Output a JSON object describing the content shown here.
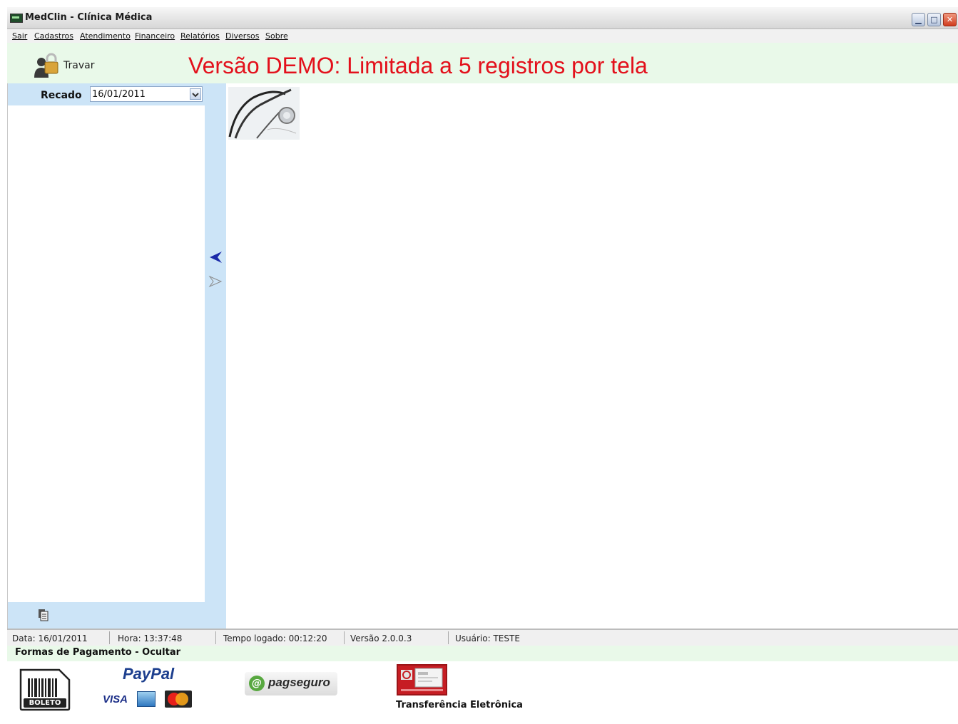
{
  "window": {
    "title": "MedClin - Clínica Médica",
    "controls": [
      "minimize",
      "maximize",
      "close"
    ]
  },
  "menu": [
    "Sair",
    "Cadastros",
    "Atendimento",
    "Financeiro",
    "Relatórios",
    "Diversos",
    "Sobre"
  ],
  "toolbar": {
    "lock_label": "Travar",
    "demo_banner": "Versão DEMO: Limitada a 5 registros por tela",
    "banner_color": "#e3101b"
  },
  "left_panel": {
    "label": "Recado",
    "date_value": "16/01/2011",
    "header_color": "#cce4f7"
  },
  "status": {
    "date": "Data: 16/01/2011",
    "time": "Hora: 13:37:48",
    "logged_time": "Tempo logado: 00:12:20",
    "version": "Versão 2.0.0.3",
    "user": "Usuário: TESTE"
  },
  "payment": {
    "header": "Formas de Pagamento - Ocultar",
    "boleto": "BOLETO",
    "paypal": "PayPal",
    "visa": "VISA",
    "pagseguro": "pagseguro",
    "transfer": "Transferência Eletrônica"
  }
}
